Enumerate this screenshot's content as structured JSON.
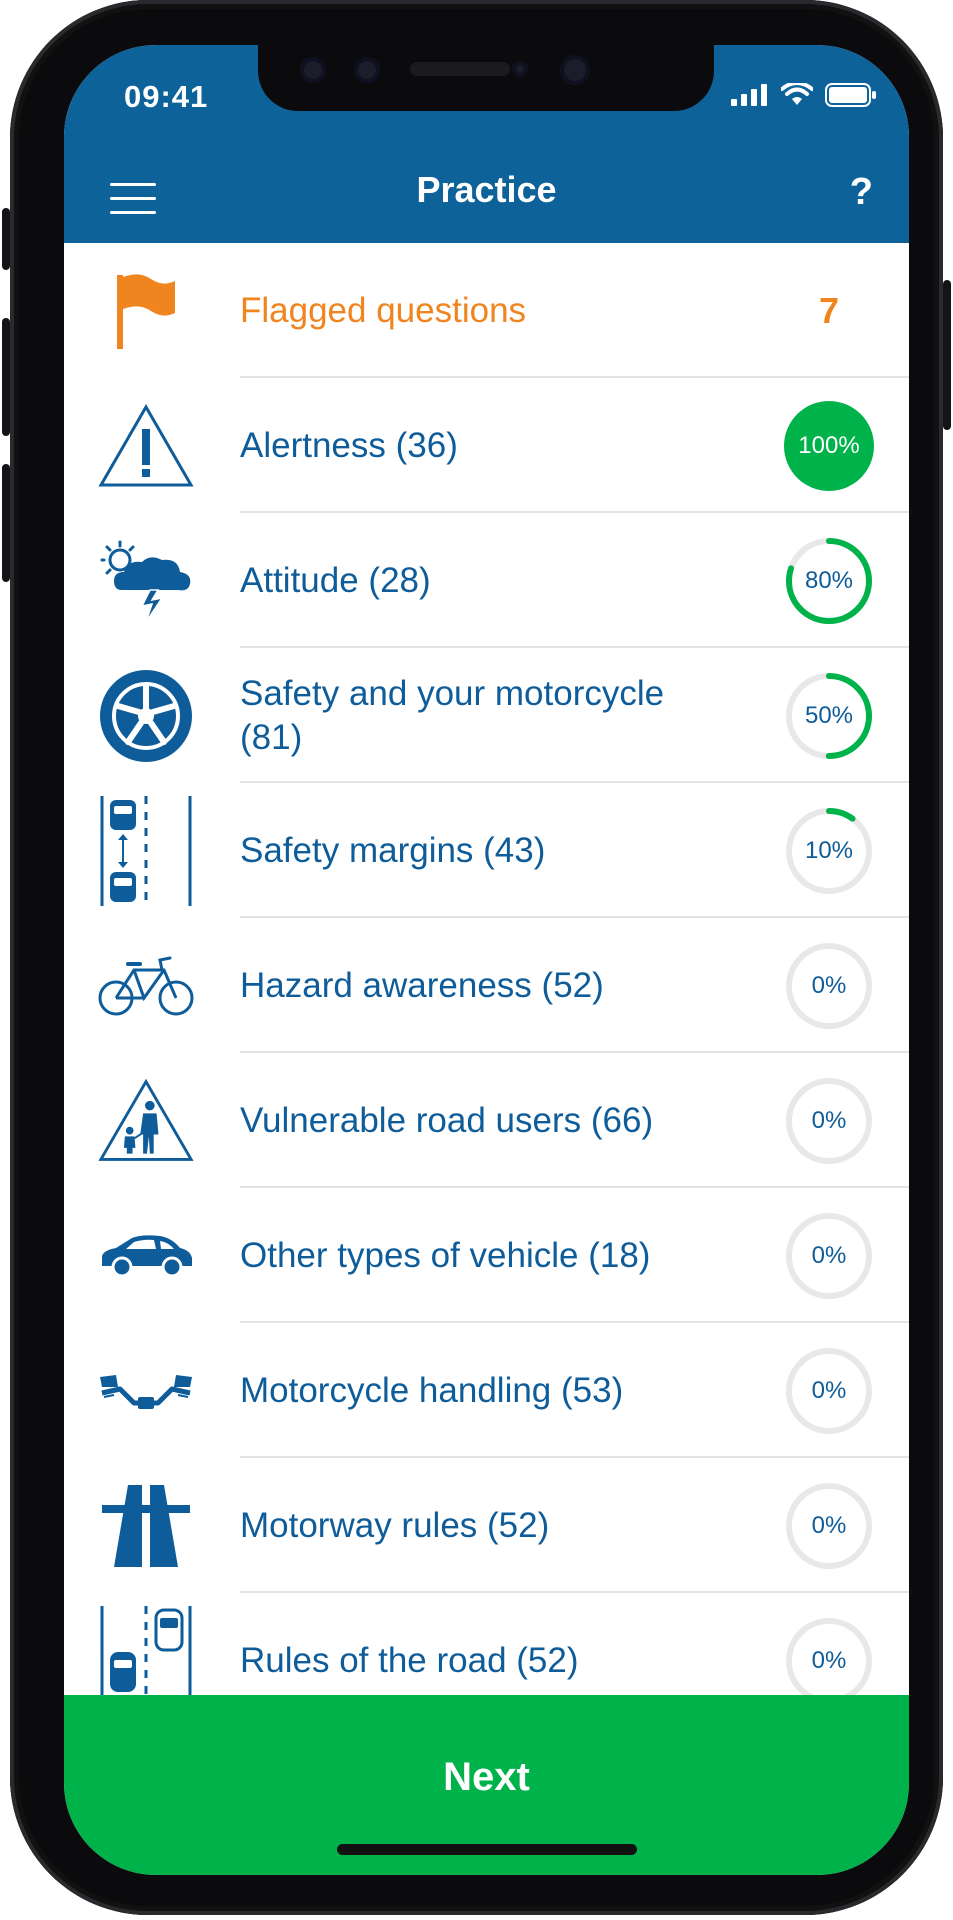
{
  "status_bar": {
    "time": "09:41"
  },
  "header": {
    "title": "Practice",
    "help_glyph": "?"
  },
  "flagged": {
    "label": "Flagged questions",
    "count": "7",
    "color": "#f0851f"
  },
  "topics": [
    {
      "label": "Alertness (36)",
      "percent_text": "100%",
      "progress": 1.0,
      "icon": "warning-triangle-icon"
    },
    {
      "label": "Attitude (28)",
      "percent_text": "80%",
      "progress": 0.8,
      "icon": "weather-storm-icon"
    },
    {
      "label": "Safety and your motorcycle (81)",
      "percent_text": "50%",
      "progress": 0.5,
      "icon": "wheel-icon"
    },
    {
      "label": "Safety margins (43)",
      "percent_text": "10%",
      "progress": 0.1,
      "icon": "safety-margins-icon"
    },
    {
      "label": "Hazard awareness (52)",
      "percent_text": "0%",
      "progress": 0,
      "icon": "bicycle-icon"
    },
    {
      "label": "Vulnerable road users (66)",
      "percent_text": "0%",
      "progress": 0,
      "icon": "pedestrians-triangle-icon"
    },
    {
      "label": "Other types of vehicle (18)",
      "percent_text": "0%",
      "progress": 0,
      "icon": "car-icon"
    },
    {
      "label": "Motorcycle handling (53)",
      "percent_text": "0%",
      "progress": 0,
      "icon": "handlebars-icon"
    },
    {
      "label": "Motorway rules (52)",
      "percent_text": "0%",
      "progress": 0,
      "icon": "motorway-icon"
    },
    {
      "label": "Rules of the road (52)",
      "percent_text": "0%",
      "progress": 0,
      "icon": "road-lanes-icon"
    }
  ],
  "footer": {
    "next_label": "Next"
  },
  "colors": {
    "primary": "#0e629a",
    "text": "#0e5c99",
    "accent": "#00b24a",
    "ring_track": "#e8e8e8"
  }
}
